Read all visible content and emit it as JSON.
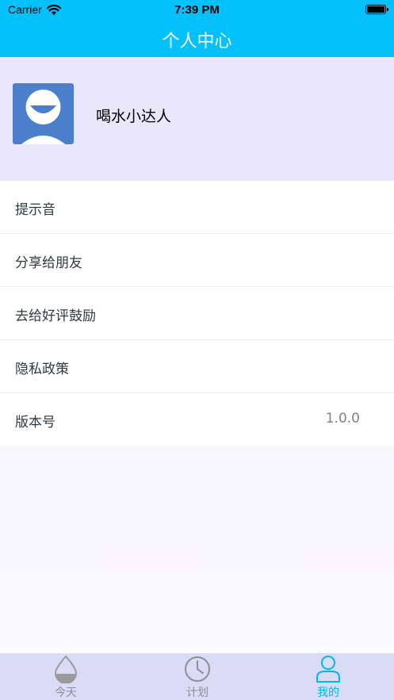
{
  "status_bar": {
    "carrier": "Carrier",
    "time": "7:39 PM"
  },
  "nav": {
    "title": "个人中心"
  },
  "profile": {
    "name": "喝水小达人"
  },
  "menu": [
    {
      "label": "提示音",
      "value": ""
    },
    {
      "label": "分享给朋友",
      "value": ""
    },
    {
      "label": "去给好评鼓励",
      "value": ""
    },
    {
      "label": "隐私政策",
      "value": ""
    },
    {
      "label": "版本号",
      "value": "1.0.0"
    }
  ],
  "tabs": [
    {
      "label": "今天",
      "icon": "water-drop-icon",
      "active": false
    },
    {
      "label": "计划",
      "icon": "clock-icon",
      "active": false
    },
    {
      "label": "我的",
      "icon": "person-icon",
      "active": true
    }
  ],
  "colors": {
    "accent": "#05c1fb",
    "profile_bg": "#eae6fc",
    "tabbar_bg": "#d9dcf6",
    "avatar_bg": "#4b7fcb"
  }
}
